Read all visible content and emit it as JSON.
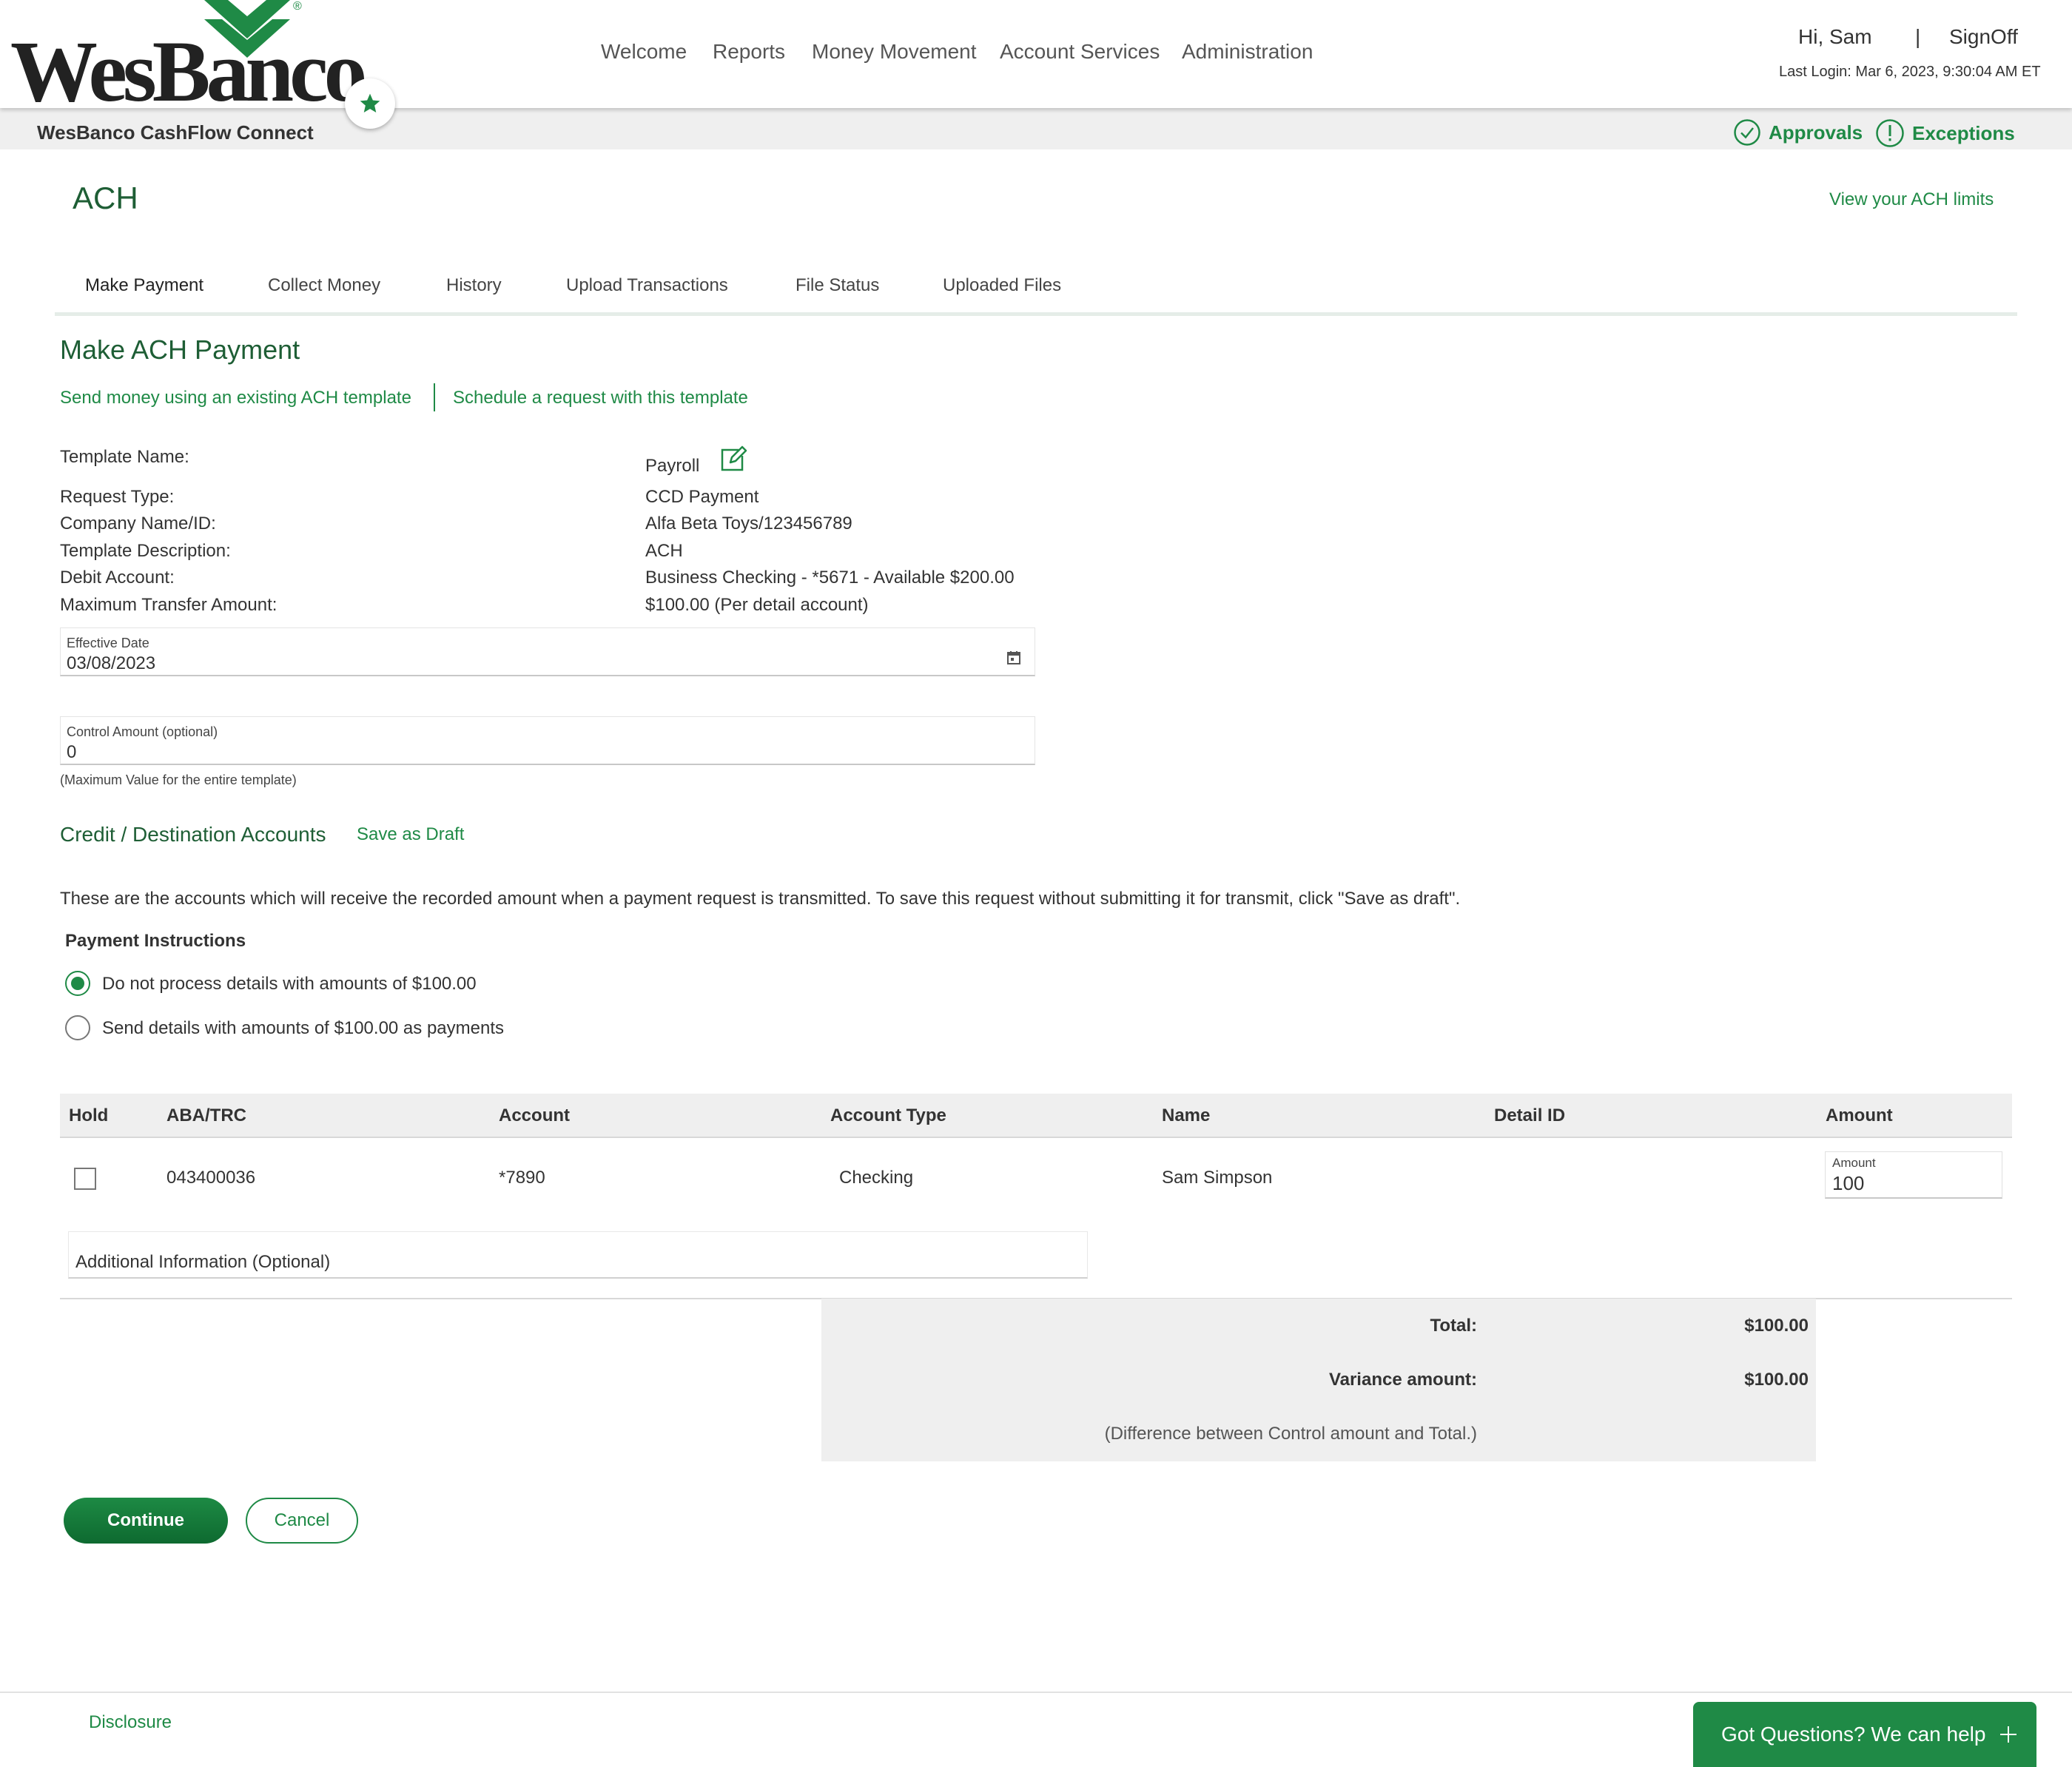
{
  "brand": {
    "logo_text": "WesBanco",
    "registered_mark": "®",
    "product_name": "WesBanco CashFlow Connect",
    "accent_color": "#1f8a46",
    "dark_green": "#1e5e35"
  },
  "nav": {
    "items": [
      "Welcome",
      "Reports",
      "Money Movement",
      "Account Services",
      "Administration"
    ]
  },
  "user": {
    "greeting": "Hi, Sam",
    "separator": "|",
    "signoff_label": "SignOff",
    "last_login": "Last Login: Mar 6, 2023, 9:30:04 AM ET"
  },
  "quick_links": {
    "approvals_label": "Approvals",
    "approvals_icon": "check-circle-icon",
    "exceptions_label": "Exceptions",
    "exceptions_icon": "exclamation-circle-icon",
    "favorite_icon": "star-icon"
  },
  "page": {
    "title": "ACH",
    "limits_link": "View your ACH limits"
  },
  "tabs": [
    "Make Payment",
    "Collect Money",
    "History",
    "Upload Transactions",
    "File Status",
    "Uploaded Files"
  ],
  "active_tab": "Make Payment",
  "form": {
    "section_title": "Make ACH Payment",
    "link_existing": "Send money using an existing ACH template",
    "link_schedule": "Schedule a request with this template",
    "details": [
      {
        "label": "Template Name:",
        "value": "Payroll"
      },
      {
        "label": "Request Type:",
        "value": "CCD Payment"
      },
      {
        "label": "Company Name/ID:",
        "value": "Alfa Beta Toys/123456789"
      },
      {
        "label": "Template Description:",
        "value": "ACH"
      },
      {
        "label": "Debit Account:",
        "value": "Business Checking - *5671 - Available $200.00"
      },
      {
        "label": "Maximum Transfer Amount:",
        "value": "$100.00 (Per detail account)"
      }
    ],
    "edit_icon": "edit-icon",
    "effective_date": {
      "label": "Effective Date",
      "value": "03/08/2023",
      "icon": "calendar-icon"
    },
    "control_amount": {
      "label": "Control Amount (optional)",
      "value": "0"
    },
    "control_hint": "(Maximum Value for the entire template)"
  },
  "credit": {
    "title": "Credit / Destination Accounts",
    "save_draft": "Save as Draft",
    "description": "These are the accounts which will receive the recorded amount when a payment request is transmitted. To save this request without submitting it for transmit, click \"Save as draft\".",
    "payment_instructions_title": "Payment Instructions",
    "options": [
      {
        "label": "Do not process details with amounts of $100.00",
        "selected": true
      },
      {
        "label": "Send details with amounts of $100.00 as payments",
        "selected": false
      }
    ]
  },
  "table": {
    "headers": [
      "Hold",
      "ABA/TRC",
      "Account",
      "Account Type",
      "Name",
      "Detail ID",
      "Amount"
    ],
    "rows": [
      {
        "hold": false,
        "aba": "043400036",
        "account": "*7890",
        "type": "Checking",
        "name": "Sam Simpson",
        "detail_id": "",
        "amount_label": "Amount",
        "amount": "100"
      }
    ],
    "additional_info_placeholder": "Additional Information (Optional)"
  },
  "totals": {
    "total_label": "Total:",
    "total_value": "$100.00",
    "variance_label": "Variance amount:",
    "variance_value": "$100.00",
    "note": "(Difference between Control amount and Total.)"
  },
  "buttons": {
    "continue": "Continue",
    "cancel": "Cancel"
  },
  "footer": {
    "disclosure": "Disclosure",
    "help": "Got Questions? We can help",
    "help_icon": "plus-icon"
  }
}
